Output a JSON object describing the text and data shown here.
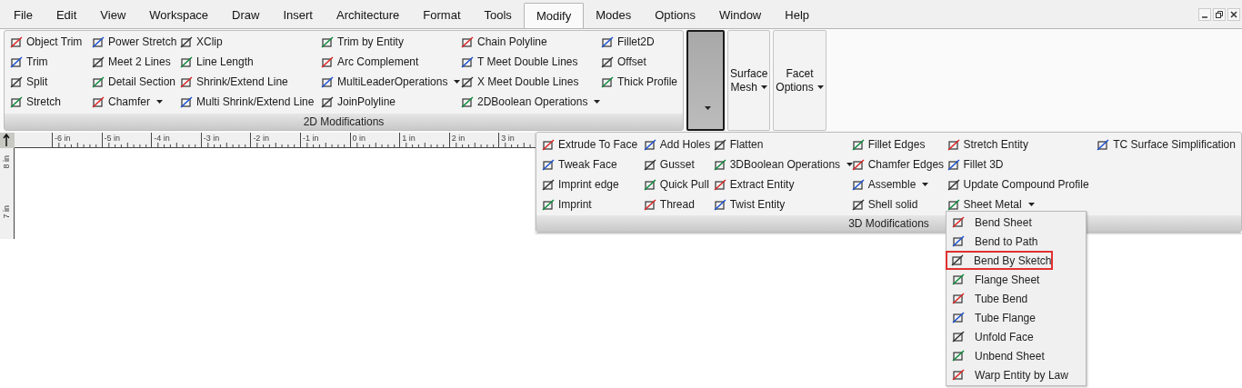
{
  "menu": [
    {
      "label": "File",
      "selected": false
    },
    {
      "label": "Edit",
      "selected": false
    },
    {
      "label": "View",
      "selected": false
    },
    {
      "label": "Workspace",
      "selected": false
    },
    {
      "label": "Draw",
      "selected": false
    },
    {
      "label": "Insert",
      "selected": false
    },
    {
      "label": "Architecture",
      "selected": false
    },
    {
      "label": "Format",
      "selected": false
    },
    {
      "label": "Tools",
      "selected": false
    },
    {
      "label": "Modify",
      "selected": true
    },
    {
      "label": "Modes",
      "selected": false
    },
    {
      "label": "Options",
      "selected": false
    },
    {
      "label": "Window",
      "selected": false
    },
    {
      "label": "Help",
      "selected": false
    }
  ],
  "panel_2d": {
    "title": "2D Modifications",
    "columns": [
      [
        {
          "label": "Object Trim"
        },
        {
          "label": "Trim"
        },
        {
          "label": "Split"
        },
        {
          "label": "Stretch"
        }
      ],
      [
        {
          "label": "Power Stretch"
        },
        {
          "label": "Meet 2 Lines"
        },
        {
          "label": "Detail Section"
        },
        {
          "label": "Chamfer",
          "dropdown": true
        }
      ],
      [
        {
          "label": "XClip"
        },
        {
          "label": "Line Length"
        },
        {
          "label": "Shrink/Extend Line"
        },
        {
          "label": "Multi Shrink/Extend Line"
        }
      ],
      [
        {
          "label": "Trim by Entity"
        },
        {
          "label": "Arc Complement"
        },
        {
          "label": "MultiLeaderOperations",
          "dropdown": true
        },
        {
          "label": "JoinPolyline"
        }
      ],
      [
        {
          "label": "Chain Polyline"
        },
        {
          "label": "T Meet Double Lines"
        },
        {
          "label": "X Meet Double Lines"
        },
        {
          "label": "2DBoolean Operations",
          "dropdown": true
        }
      ],
      [
        {
          "label": "Fillet2D"
        },
        {
          "label": "Offset"
        },
        {
          "label": "Thick Profile"
        }
      ]
    ]
  },
  "big_buttons": [
    {
      "pressed": true,
      "dropdown": true
    },
    {
      "lines": [
        "Surface",
        "Mesh"
      ],
      "pressed": false,
      "dropdown": true
    },
    {
      "lines": [
        "Facet",
        "Options"
      ],
      "pressed": false,
      "dropdown": true
    }
  ],
  "ruler": {
    "horizontal": [
      "-6 in",
      "-5 in",
      "-4 in",
      "-3 in",
      "-2 in",
      "-1 in",
      "0 in",
      "1 in",
      "2 in",
      "3 in"
    ],
    "vertical": [
      "8 in",
      "7 in"
    ]
  },
  "panel_3d": {
    "title": "3D Modifications",
    "columns": [
      [
        {
          "label": "Extrude To Face"
        },
        {
          "label": "Tweak Face"
        },
        {
          "label": "Imprint edge"
        },
        {
          "label": "Imprint"
        }
      ],
      [
        {
          "label": "Add Holes"
        },
        {
          "label": "Gusset"
        },
        {
          "label": "Quick Pull"
        },
        {
          "label": "Thread"
        }
      ],
      [
        {
          "label": "Flatten"
        },
        {
          "label": "3DBoolean Operations",
          "dropdown": true
        },
        {
          "label": "Extract Entity"
        },
        {
          "label": "Twist Entity"
        }
      ],
      [
        {
          "label": "Fillet Edges"
        },
        {
          "label": "Chamfer Edges"
        },
        {
          "label": "Assemble",
          "dropdown": true
        },
        {
          "label": "Shell solid"
        }
      ],
      [
        {
          "label": "Stretch Entity"
        },
        {
          "label": "Fillet 3D"
        },
        {
          "label": "Update Compound Profile"
        },
        {
          "label": "Sheet Metal",
          "dropdown": true
        }
      ],
      [
        {
          "label": "TC Surface Simplification"
        }
      ]
    ]
  },
  "sheet_metal_menu": [
    {
      "label": "Bend Sheet",
      "selected": false
    },
    {
      "label": "Bend to Path",
      "selected": false
    },
    {
      "label": "Bend By Sketch",
      "selected": true
    },
    {
      "label": "Flange Sheet",
      "selected": false
    },
    {
      "label": "Tube Bend",
      "selected": false
    },
    {
      "label": "Tube Flange",
      "selected": false
    },
    {
      "label": "Unfold Face",
      "selected": false
    },
    {
      "label": "Unbend Sheet",
      "selected": false
    },
    {
      "label": "Warp Entity by Law",
      "selected": false
    }
  ]
}
